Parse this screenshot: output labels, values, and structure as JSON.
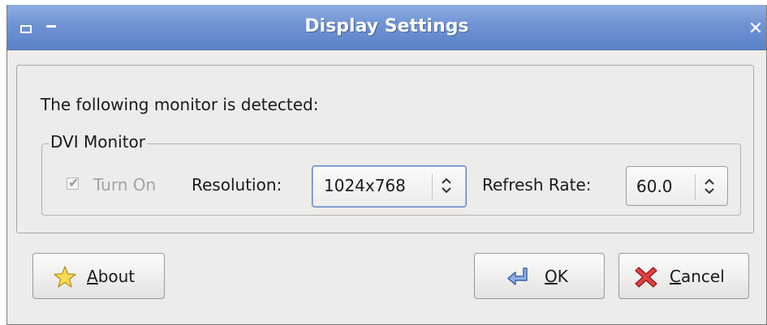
{
  "window": {
    "title": "Display Settings"
  },
  "content": {
    "detected_text": "The following monitor is detected:",
    "group": {
      "title": "DVI Monitor",
      "turn_on": {
        "label": "Turn On",
        "checked": true,
        "enabled": false
      },
      "resolution": {
        "label": "Resolution:",
        "value": "1024x768"
      },
      "refresh_rate": {
        "label": "Refresh Rate:",
        "value": "60.0"
      }
    }
  },
  "buttons": {
    "about": {
      "mnemonic": "A",
      "rest": "bout",
      "icon": "star-icon"
    },
    "ok": {
      "mnemonic": "O",
      "rest": "K",
      "icon": "enter-arrow-icon"
    },
    "cancel": {
      "mnemonic": "C",
      "rest": "ancel",
      "icon": "red-x-icon"
    }
  },
  "colors": {
    "titlebar": "#6f93d4",
    "window_bg": "#edeceb",
    "focus_border": "#5e81bf"
  }
}
